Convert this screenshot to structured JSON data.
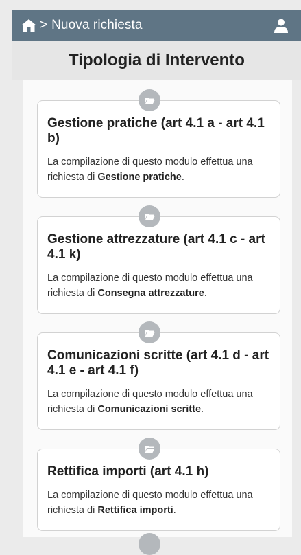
{
  "header": {
    "home_icon": "home-icon",
    "separator": ">",
    "breadcrumb": "Nuova richiesta",
    "user_icon": "user-icon",
    "bg_color": "#5f7585"
  },
  "page_title": "Tipologia di Intervento",
  "cards": [
    {
      "icon": "folder-icon",
      "title": "Gestione pratiche (art 4.1 a - art 4.1 b)",
      "desc_prefix": "La compilazione di questo modulo effettua una richiesta di ",
      "desc_bold": "Gestione pratiche",
      "desc_suffix": "."
    },
    {
      "icon": "folder-icon",
      "title": "Gestione attrezzature (art 4.1 c - art 4.1 k)",
      "desc_prefix": "La compilazione di questo modulo effettua una richiesta di ",
      "desc_bold": "Consegna attrezzature",
      "desc_suffix": "."
    },
    {
      "icon": "folder-icon",
      "title": "Comunicazioni scritte (art 4.1 d - art 4.1 e - art 4.1 f)",
      "desc_prefix": "La compilazione di questo modulo effettua una richiesta di ",
      "desc_bold": "Comunicazioni scritte",
      "desc_suffix": "."
    },
    {
      "icon": "folder-icon",
      "title": "Rettifica importi (art 4.1 h)",
      "desc_prefix": "La compilazione di questo modulo effettua una richiesta di ",
      "desc_bold": "Rettifica importi",
      "desc_suffix": "."
    }
  ]
}
